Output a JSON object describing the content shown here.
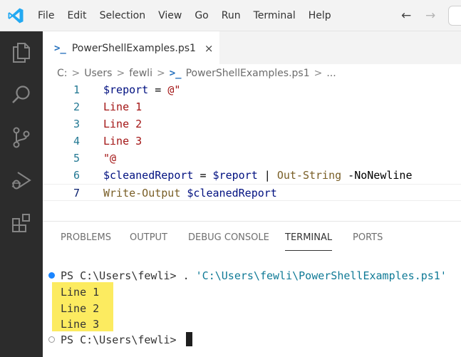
{
  "menu": {
    "items": [
      "File",
      "Edit",
      "Selection",
      "View",
      "Go",
      "Run",
      "Terminal",
      "Help"
    ]
  },
  "nav": {
    "back": "←",
    "forward": "→"
  },
  "activity_bar": {
    "icons": [
      "files-icon",
      "search-icon",
      "source-control-icon",
      "run-debug-icon",
      "extensions-icon"
    ]
  },
  "tab": {
    "icon_glyph": ">_",
    "label": "PowerShellExamples.ps1",
    "close": "×"
  },
  "breadcrumb": {
    "parts": [
      "C:",
      "Users",
      "fewli"
    ],
    "file": "PowerShellExamples.ps1",
    "separator": ">",
    "ellipsis": "..."
  },
  "editor": {
    "lines": [
      {
        "number": "1",
        "tokens": [
          [
            "var",
            "$report"
          ],
          [
            "op",
            " = "
          ],
          [
            "str",
            "@\""
          ]
        ]
      },
      {
        "number": "2",
        "tokens": [
          [
            "str",
            "Line 1"
          ]
        ]
      },
      {
        "number": "3",
        "tokens": [
          [
            "str",
            "Line 2"
          ]
        ]
      },
      {
        "number": "4",
        "tokens": [
          [
            "str",
            "Line 3"
          ]
        ]
      },
      {
        "number": "5",
        "tokens": [
          [
            "str",
            "\"@"
          ]
        ]
      },
      {
        "number": "6",
        "tokens": [
          [
            "var",
            "$cleanedReport"
          ],
          [
            "op",
            " = "
          ],
          [
            "var",
            "$report"
          ],
          [
            "op",
            " | "
          ],
          [
            "cmdlet",
            "Out-String"
          ],
          [
            "param",
            " -NoNewline"
          ]
        ]
      },
      {
        "number": "7",
        "tokens": [
          [
            "cmdlet",
            "Write-Output"
          ],
          [
            "op",
            " "
          ],
          [
            "var",
            "$cleanedReport"
          ]
        ]
      }
    ],
    "current_line": "7"
  },
  "panel": {
    "tabs": [
      "PROBLEMS",
      "OUTPUT",
      "DEBUG CONSOLE",
      "TERMINAL",
      "PORTS"
    ],
    "active_tab": "TERMINAL"
  },
  "terminal": {
    "command_prompt": "PS C:\\Users\\fewli> ",
    "command_dot": ". ",
    "command_path": "'C:\\Users\\fewli\\PowerShellExamples.ps1'",
    "output": [
      "Line 1",
      "Line 2",
      "Line 3"
    ],
    "final_prompt": "PS C:\\Users\\fewli> "
  },
  "colors": {
    "activity_bar": "#2c2c2c",
    "highlight": "#fce94f",
    "accent_blue": "#1a85ff"
  }
}
